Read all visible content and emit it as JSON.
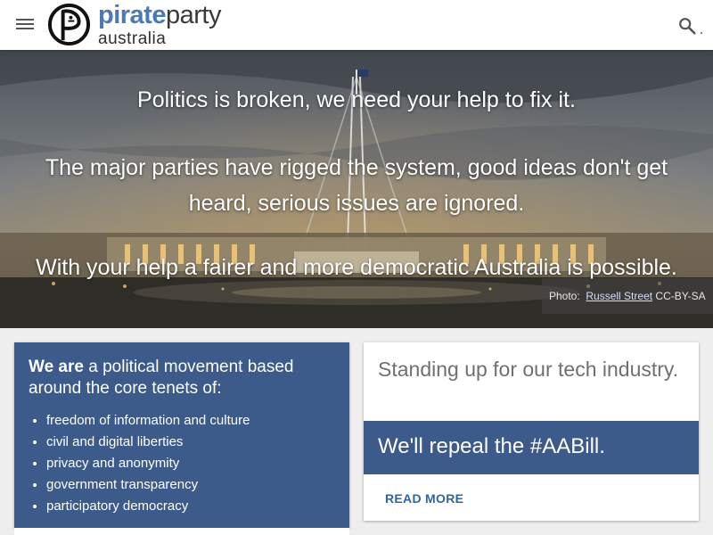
{
  "header": {
    "logo_word1": "pirate",
    "logo_word2": "party",
    "logo_subtitle": "australia",
    "menu_icon": "hamburger-menu-icon",
    "search_icon": "search-icon"
  },
  "hero": {
    "line1": "Politics is broken, we need your help to fix it.",
    "line2": "The major parties have rigged the system, good ideas don't get heard, serious issues are ignored.",
    "line3": "With your help a fairer and more democratic Australia is possible.",
    "credit_prefix": "Photo:",
    "credit_link": "Russell Street",
    "credit_license": "CC-BY-SA"
  },
  "about": {
    "intro_bold": "We are",
    "intro_rest": " a political movement based around the core tenets of:",
    "tenets": [
      "freedom of information and culture",
      "civil and digital liberties",
      "privacy and anonymity",
      "government transparency",
      "participatory democracy"
    ]
  },
  "feature": {
    "title": "Standing up for our tech industry.",
    "banner": "We'll repeal the #AABill.",
    "button": "READ MORE"
  },
  "colors": {
    "brand_blue": "#3c5a8a",
    "logo_blue": "#4a7ab5",
    "link_blue": "#2d66a6"
  }
}
